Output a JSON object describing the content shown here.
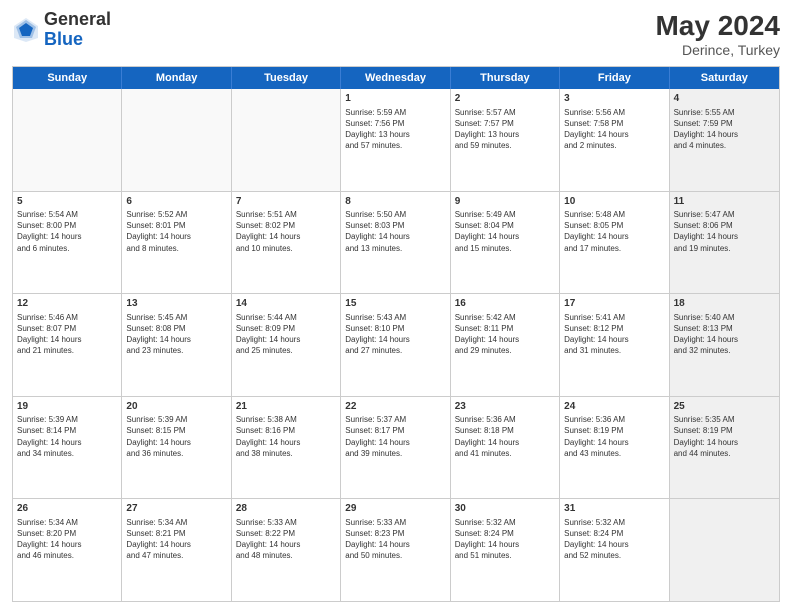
{
  "header": {
    "logo_general": "General",
    "logo_blue": "Blue",
    "month_year": "May 2024",
    "location": "Derince, Turkey"
  },
  "weekdays": [
    "Sunday",
    "Monday",
    "Tuesday",
    "Wednesday",
    "Thursday",
    "Friday",
    "Saturday"
  ],
  "rows": [
    [
      {
        "day": "",
        "text": "",
        "empty": true
      },
      {
        "day": "",
        "text": "",
        "empty": true
      },
      {
        "day": "",
        "text": "",
        "empty": true
      },
      {
        "day": "1",
        "text": "Sunrise: 5:59 AM\nSunset: 7:56 PM\nDaylight: 13 hours\nand 57 minutes."
      },
      {
        "day": "2",
        "text": "Sunrise: 5:57 AM\nSunset: 7:57 PM\nDaylight: 13 hours\nand 59 minutes."
      },
      {
        "day": "3",
        "text": "Sunrise: 5:56 AM\nSunset: 7:58 PM\nDaylight: 14 hours\nand 2 minutes."
      },
      {
        "day": "4",
        "text": "Sunrise: 5:55 AM\nSunset: 7:59 PM\nDaylight: 14 hours\nand 4 minutes.",
        "shaded": true
      }
    ],
    [
      {
        "day": "5",
        "text": "Sunrise: 5:54 AM\nSunset: 8:00 PM\nDaylight: 14 hours\nand 6 minutes."
      },
      {
        "day": "6",
        "text": "Sunrise: 5:52 AM\nSunset: 8:01 PM\nDaylight: 14 hours\nand 8 minutes."
      },
      {
        "day": "7",
        "text": "Sunrise: 5:51 AM\nSunset: 8:02 PM\nDaylight: 14 hours\nand 10 minutes."
      },
      {
        "day": "8",
        "text": "Sunrise: 5:50 AM\nSunset: 8:03 PM\nDaylight: 14 hours\nand 13 minutes."
      },
      {
        "day": "9",
        "text": "Sunrise: 5:49 AM\nSunset: 8:04 PM\nDaylight: 14 hours\nand 15 minutes."
      },
      {
        "day": "10",
        "text": "Sunrise: 5:48 AM\nSunset: 8:05 PM\nDaylight: 14 hours\nand 17 minutes."
      },
      {
        "day": "11",
        "text": "Sunrise: 5:47 AM\nSunset: 8:06 PM\nDaylight: 14 hours\nand 19 minutes.",
        "shaded": true
      }
    ],
    [
      {
        "day": "12",
        "text": "Sunrise: 5:46 AM\nSunset: 8:07 PM\nDaylight: 14 hours\nand 21 minutes."
      },
      {
        "day": "13",
        "text": "Sunrise: 5:45 AM\nSunset: 8:08 PM\nDaylight: 14 hours\nand 23 minutes."
      },
      {
        "day": "14",
        "text": "Sunrise: 5:44 AM\nSunset: 8:09 PM\nDaylight: 14 hours\nand 25 minutes."
      },
      {
        "day": "15",
        "text": "Sunrise: 5:43 AM\nSunset: 8:10 PM\nDaylight: 14 hours\nand 27 minutes."
      },
      {
        "day": "16",
        "text": "Sunrise: 5:42 AM\nSunset: 8:11 PM\nDaylight: 14 hours\nand 29 minutes."
      },
      {
        "day": "17",
        "text": "Sunrise: 5:41 AM\nSunset: 8:12 PM\nDaylight: 14 hours\nand 31 minutes."
      },
      {
        "day": "18",
        "text": "Sunrise: 5:40 AM\nSunset: 8:13 PM\nDaylight: 14 hours\nand 32 minutes.",
        "shaded": true
      }
    ],
    [
      {
        "day": "19",
        "text": "Sunrise: 5:39 AM\nSunset: 8:14 PM\nDaylight: 14 hours\nand 34 minutes."
      },
      {
        "day": "20",
        "text": "Sunrise: 5:39 AM\nSunset: 8:15 PM\nDaylight: 14 hours\nand 36 minutes."
      },
      {
        "day": "21",
        "text": "Sunrise: 5:38 AM\nSunset: 8:16 PM\nDaylight: 14 hours\nand 38 minutes."
      },
      {
        "day": "22",
        "text": "Sunrise: 5:37 AM\nSunset: 8:17 PM\nDaylight: 14 hours\nand 39 minutes."
      },
      {
        "day": "23",
        "text": "Sunrise: 5:36 AM\nSunset: 8:18 PM\nDaylight: 14 hours\nand 41 minutes."
      },
      {
        "day": "24",
        "text": "Sunrise: 5:36 AM\nSunset: 8:19 PM\nDaylight: 14 hours\nand 43 minutes."
      },
      {
        "day": "25",
        "text": "Sunrise: 5:35 AM\nSunset: 8:19 PM\nDaylight: 14 hours\nand 44 minutes.",
        "shaded": true
      }
    ],
    [
      {
        "day": "26",
        "text": "Sunrise: 5:34 AM\nSunset: 8:20 PM\nDaylight: 14 hours\nand 46 minutes."
      },
      {
        "day": "27",
        "text": "Sunrise: 5:34 AM\nSunset: 8:21 PM\nDaylight: 14 hours\nand 47 minutes."
      },
      {
        "day": "28",
        "text": "Sunrise: 5:33 AM\nSunset: 8:22 PM\nDaylight: 14 hours\nand 48 minutes."
      },
      {
        "day": "29",
        "text": "Sunrise: 5:33 AM\nSunset: 8:23 PM\nDaylight: 14 hours\nand 50 minutes."
      },
      {
        "day": "30",
        "text": "Sunrise: 5:32 AM\nSunset: 8:24 PM\nDaylight: 14 hours\nand 51 minutes."
      },
      {
        "day": "31",
        "text": "Sunrise: 5:32 AM\nSunset: 8:24 PM\nDaylight: 14 hours\nand 52 minutes."
      },
      {
        "day": "",
        "text": "",
        "empty": true,
        "shaded": true
      }
    ]
  ]
}
